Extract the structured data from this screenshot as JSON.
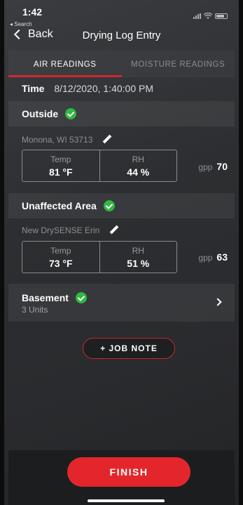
{
  "status_bar": {
    "time": "1:42",
    "back_app": "◂ Search"
  },
  "nav": {
    "back_label": "Back",
    "title": "Drying Log Entry"
  },
  "tabs": [
    {
      "label": "AIR READINGS",
      "active": true
    },
    {
      "label": "MOISTURE READINGS",
      "active": false
    }
  ],
  "time_row": {
    "label": "Time",
    "value": "8/12/2020, 1:40:00 PM"
  },
  "sections": {
    "outside": {
      "title": "Outside",
      "device": "Monona, WI 53713",
      "temp_label": "Temp",
      "temp_value": "81 °F",
      "rh_label": "RH",
      "rh_value": "44 %",
      "gpp_label": "gpp",
      "gpp_value": "70"
    },
    "unaffected": {
      "title": "Unaffected Area",
      "device": "New DrySENSE Erin",
      "temp_label": "Temp",
      "temp_value": "73 °F",
      "rh_label": "RH",
      "rh_value": "51 %",
      "gpp_label": "gpp",
      "gpp_value": "63"
    },
    "basement": {
      "title": "Basement",
      "units": "3 Units"
    }
  },
  "buttons": {
    "job_note": "+ JOB NOTE",
    "finish": "FINISH"
  },
  "colors": {
    "accent_red": "#e3262c",
    "check_green": "#2fb842"
  },
  "icons": [
    "check-circle-icon",
    "pencil-icon",
    "chevron-right-icon",
    "chevron-left-icon"
  ]
}
